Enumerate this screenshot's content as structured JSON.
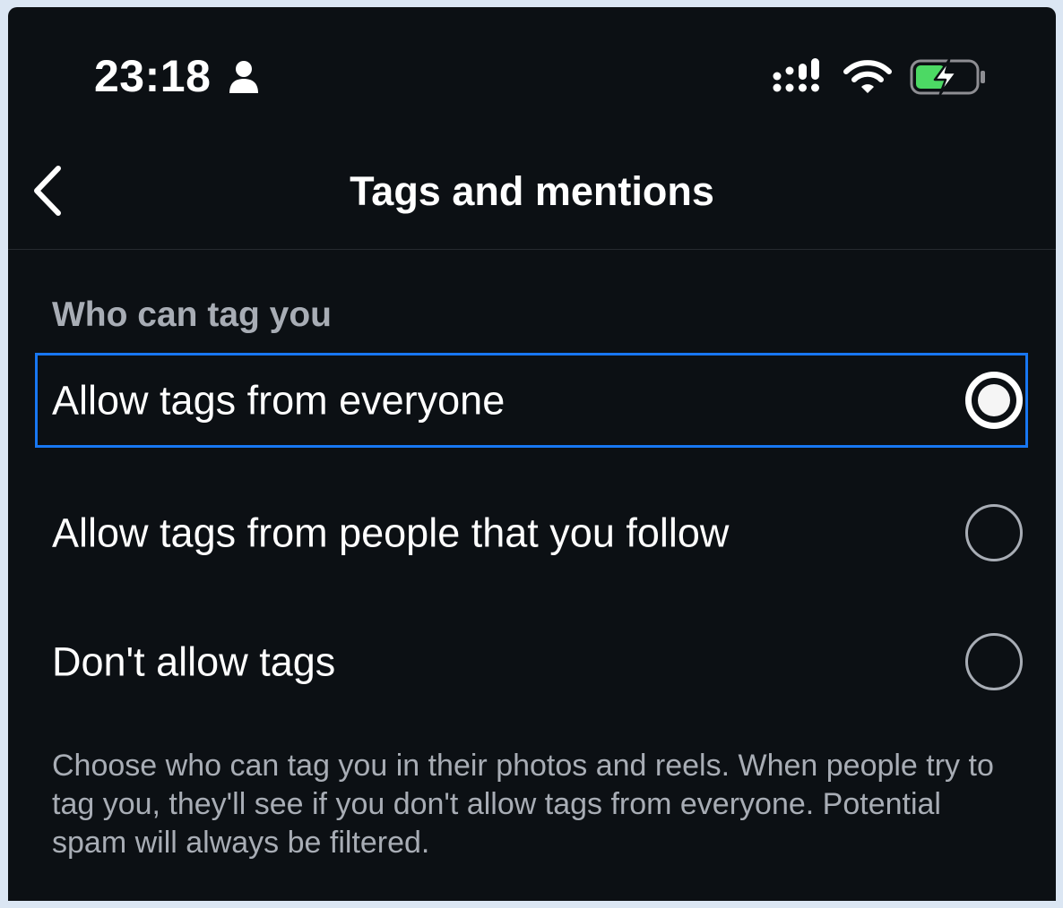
{
  "status_bar": {
    "time": "23:18",
    "battery_color": "#4cd964"
  },
  "header": {
    "title": "Tags and mentions"
  },
  "section": {
    "heading": "Who can tag you",
    "options": [
      {
        "label": "Allow tags from everyone",
        "selected": true
      },
      {
        "label": "Allow tags from people that you follow",
        "selected": false
      },
      {
        "label": "Don't allow tags",
        "selected": false
      }
    ],
    "description": "Choose who can tag you in their photos and reels. When people try to tag you, they'll see if you don't allow tags from everyone. Potential spam will always be filtered."
  },
  "colors": {
    "background": "#0c1014",
    "focus_outline": "#1877f2",
    "secondary_text": "#a8adb5"
  }
}
